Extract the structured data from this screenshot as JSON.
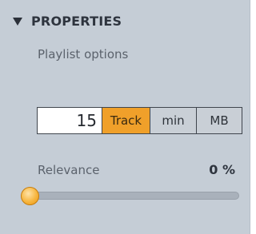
{
  "panel": {
    "title": "PROPERTIES",
    "subtitle": "Playlist options"
  },
  "limit": {
    "value": "15",
    "units": [
      {
        "label": "Track",
        "active": true
      },
      {
        "label": "min",
        "active": false
      },
      {
        "label": "MB",
        "active": false
      }
    ]
  },
  "relevance": {
    "label": "Relevance",
    "value_text": "0 %",
    "value": 0
  },
  "colors": {
    "panel_bg": "#c5cdd6",
    "accent": "#f0a02a"
  },
  "icons": {
    "collapse": "triangle-down-icon"
  }
}
